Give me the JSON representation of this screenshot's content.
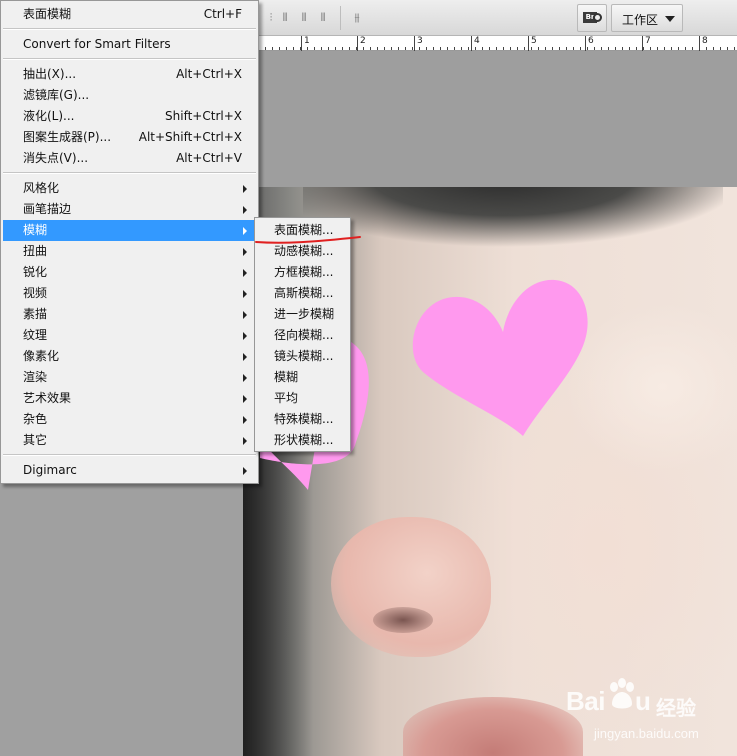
{
  "toolbar": {
    "icons": [
      "align-bottom-icon",
      "align-left-icon",
      "align-hcenter-icon",
      "align-right-icon",
      "auto-align-icon"
    ],
    "bridge_icon": "br-bridge-icon",
    "bridge_text": "Br",
    "workspace_label": "工作区"
  },
  "ruler": {
    "labels": [
      "1",
      "2",
      "3",
      "4",
      "5",
      "6",
      "7",
      "8"
    ]
  },
  "filter_menu": {
    "last_filter": {
      "label": "表面模糊",
      "shortcut": "Ctrl+F"
    },
    "convert_smart": {
      "label": "Convert for Smart Filters"
    },
    "group1": [
      {
        "label": "抽出(X)...",
        "shortcut": "Alt+Ctrl+X"
      },
      {
        "label": "滤镜库(G)...",
        "shortcut": ""
      },
      {
        "label": "液化(L)...",
        "shortcut": "Shift+Ctrl+X"
      },
      {
        "label": "图案生成器(P)...",
        "shortcut": "Alt+Shift+Ctrl+X"
      },
      {
        "label": "消失点(V)...",
        "shortcut": "Alt+Ctrl+V"
      }
    ],
    "group2": [
      {
        "label": "风格化"
      },
      {
        "label": "画笔描边"
      },
      {
        "label": "模糊"
      },
      {
        "label": "扭曲"
      },
      {
        "label": "锐化"
      },
      {
        "label": "视频"
      },
      {
        "label": "素描"
      },
      {
        "label": "纹理"
      },
      {
        "label": "像素化"
      },
      {
        "label": "渲染"
      },
      {
        "label": "艺术效果"
      },
      {
        "label": "杂色"
      },
      {
        "label": "其它"
      }
    ],
    "digimarc": {
      "label": "Digimarc"
    },
    "highlighted": "模糊"
  },
  "blur_submenu": {
    "items": [
      "表面模糊...",
      "动感模糊...",
      "方框模糊...",
      "高斯模糊...",
      "进一步模糊",
      "径向模糊...",
      "镜头模糊...",
      "模糊",
      "平均",
      "特殊模糊...",
      "形状模糊..."
    ]
  },
  "watermark": {
    "brand": "Bai",
    "brand_suffix": "u",
    "jingyan": "经验",
    "url": "jingyan.baidu.com"
  },
  "colors": {
    "highlight": "#3399ff",
    "heart": "#ff99ee",
    "annotation": "#e02020"
  }
}
